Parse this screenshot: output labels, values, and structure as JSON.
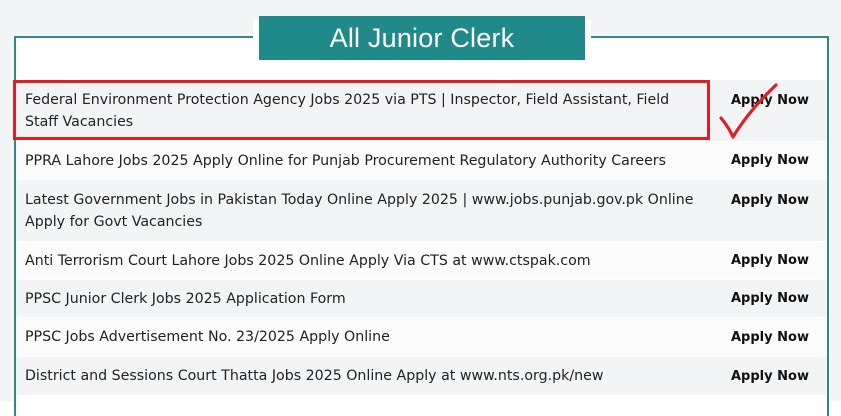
{
  "section": {
    "title": "All Junior Clerk"
  },
  "jobs": [
    {
      "title": "Federal Environment Protection Agency Jobs 2025 via PTS | Inspector, Field Assistant, Field Staff Vacancies",
      "action": "Apply Now"
    },
    {
      "title": "PPRA Lahore Jobs 2025 Apply Online for Punjab Procurement Regulatory Authority Careers",
      "action": "Apply Now"
    },
    {
      "title": "Latest Government Jobs in Pakistan Today Online Apply 2025 | www.jobs.punjab.gov.pk Online Apply for Govt Vacancies",
      "action": "Apply Now"
    },
    {
      "title": "Anti Terrorism Court Lahore Jobs 2025 Online Apply Via CTS at www.ctspak.com",
      "action": "Apply Now"
    },
    {
      "title": "PPSC Junior Clerk Jobs 2025 Application Form",
      "action": "Apply Now"
    },
    {
      "title": "PPSC Jobs Advertisement No. 23/2025 Apply Online",
      "action": "Apply Now"
    },
    {
      "title": "District and Sessions Court Thatta Jobs 2025 Online Apply at www.nts.org.pk/new",
      "action": "Apply Now"
    }
  ],
  "annotations": {
    "highlight_color": "#e01e25",
    "accent_color": "#1f8a89",
    "mark_icon": "checkmark-icon"
  }
}
